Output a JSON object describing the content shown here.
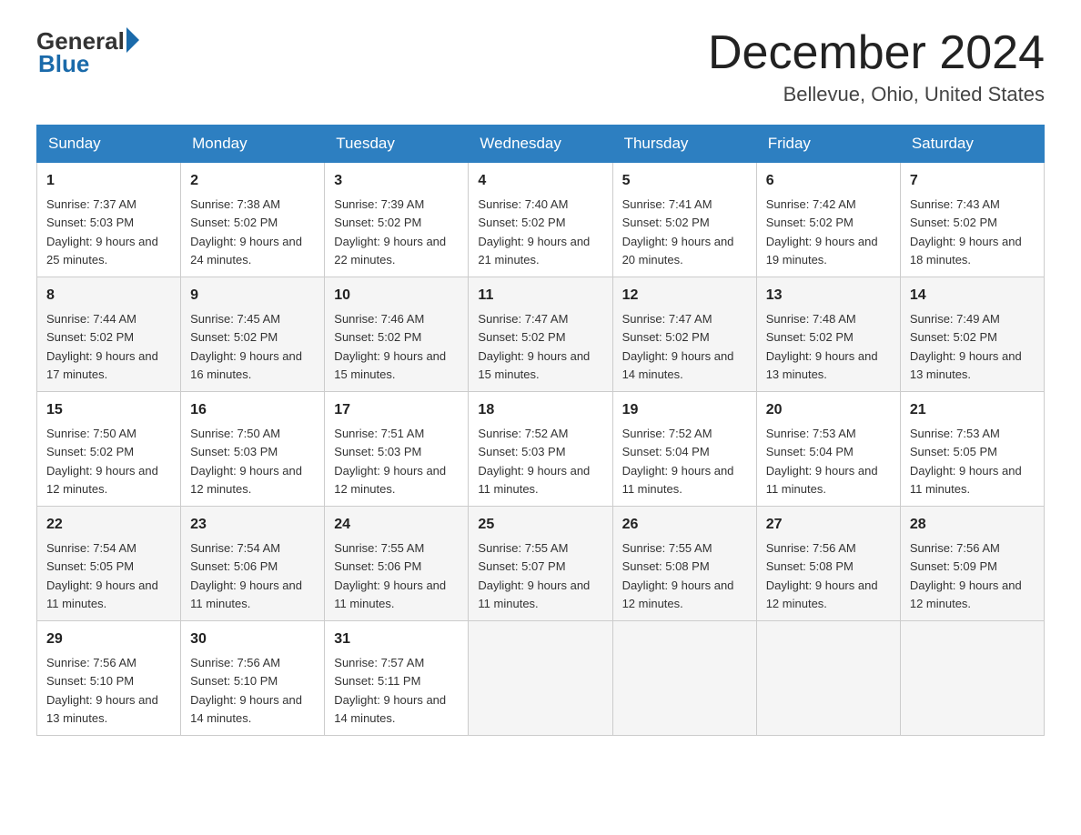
{
  "header": {
    "logo_general": "General",
    "logo_blue": "Blue",
    "month_title": "December 2024",
    "location": "Bellevue, Ohio, United States"
  },
  "days_of_week": [
    "Sunday",
    "Monday",
    "Tuesday",
    "Wednesday",
    "Thursday",
    "Friday",
    "Saturday"
  ],
  "weeks": [
    [
      {
        "day": "1",
        "sunrise": "7:37 AM",
        "sunset": "5:03 PM",
        "daylight": "9 hours and 25 minutes."
      },
      {
        "day": "2",
        "sunrise": "7:38 AM",
        "sunset": "5:02 PM",
        "daylight": "9 hours and 24 minutes."
      },
      {
        "day": "3",
        "sunrise": "7:39 AM",
        "sunset": "5:02 PM",
        "daylight": "9 hours and 22 minutes."
      },
      {
        "day": "4",
        "sunrise": "7:40 AM",
        "sunset": "5:02 PM",
        "daylight": "9 hours and 21 minutes."
      },
      {
        "day": "5",
        "sunrise": "7:41 AM",
        "sunset": "5:02 PM",
        "daylight": "9 hours and 20 minutes."
      },
      {
        "day": "6",
        "sunrise": "7:42 AM",
        "sunset": "5:02 PM",
        "daylight": "9 hours and 19 minutes."
      },
      {
        "day": "7",
        "sunrise": "7:43 AM",
        "sunset": "5:02 PM",
        "daylight": "9 hours and 18 minutes."
      }
    ],
    [
      {
        "day": "8",
        "sunrise": "7:44 AM",
        "sunset": "5:02 PM",
        "daylight": "9 hours and 17 minutes."
      },
      {
        "day": "9",
        "sunrise": "7:45 AM",
        "sunset": "5:02 PM",
        "daylight": "9 hours and 16 minutes."
      },
      {
        "day": "10",
        "sunrise": "7:46 AM",
        "sunset": "5:02 PM",
        "daylight": "9 hours and 15 minutes."
      },
      {
        "day": "11",
        "sunrise": "7:47 AM",
        "sunset": "5:02 PM",
        "daylight": "9 hours and 15 minutes."
      },
      {
        "day": "12",
        "sunrise": "7:47 AM",
        "sunset": "5:02 PM",
        "daylight": "9 hours and 14 minutes."
      },
      {
        "day": "13",
        "sunrise": "7:48 AM",
        "sunset": "5:02 PM",
        "daylight": "9 hours and 13 minutes."
      },
      {
        "day": "14",
        "sunrise": "7:49 AM",
        "sunset": "5:02 PM",
        "daylight": "9 hours and 13 minutes."
      }
    ],
    [
      {
        "day": "15",
        "sunrise": "7:50 AM",
        "sunset": "5:02 PM",
        "daylight": "9 hours and 12 minutes."
      },
      {
        "day": "16",
        "sunrise": "7:50 AM",
        "sunset": "5:03 PM",
        "daylight": "9 hours and 12 minutes."
      },
      {
        "day": "17",
        "sunrise": "7:51 AM",
        "sunset": "5:03 PM",
        "daylight": "9 hours and 12 minutes."
      },
      {
        "day": "18",
        "sunrise": "7:52 AM",
        "sunset": "5:03 PM",
        "daylight": "9 hours and 11 minutes."
      },
      {
        "day": "19",
        "sunrise": "7:52 AM",
        "sunset": "5:04 PM",
        "daylight": "9 hours and 11 minutes."
      },
      {
        "day": "20",
        "sunrise": "7:53 AM",
        "sunset": "5:04 PM",
        "daylight": "9 hours and 11 minutes."
      },
      {
        "day": "21",
        "sunrise": "7:53 AM",
        "sunset": "5:05 PM",
        "daylight": "9 hours and 11 minutes."
      }
    ],
    [
      {
        "day": "22",
        "sunrise": "7:54 AM",
        "sunset": "5:05 PM",
        "daylight": "9 hours and 11 minutes."
      },
      {
        "day": "23",
        "sunrise": "7:54 AM",
        "sunset": "5:06 PM",
        "daylight": "9 hours and 11 minutes."
      },
      {
        "day": "24",
        "sunrise": "7:55 AM",
        "sunset": "5:06 PM",
        "daylight": "9 hours and 11 minutes."
      },
      {
        "day": "25",
        "sunrise": "7:55 AM",
        "sunset": "5:07 PM",
        "daylight": "9 hours and 11 minutes."
      },
      {
        "day": "26",
        "sunrise": "7:55 AM",
        "sunset": "5:08 PM",
        "daylight": "9 hours and 12 minutes."
      },
      {
        "day": "27",
        "sunrise": "7:56 AM",
        "sunset": "5:08 PM",
        "daylight": "9 hours and 12 minutes."
      },
      {
        "day": "28",
        "sunrise": "7:56 AM",
        "sunset": "5:09 PM",
        "daylight": "9 hours and 12 minutes."
      }
    ],
    [
      {
        "day": "29",
        "sunrise": "7:56 AM",
        "sunset": "5:10 PM",
        "daylight": "9 hours and 13 minutes."
      },
      {
        "day": "30",
        "sunrise": "7:56 AM",
        "sunset": "5:10 PM",
        "daylight": "9 hours and 14 minutes."
      },
      {
        "day": "31",
        "sunrise": "7:57 AM",
        "sunset": "5:11 PM",
        "daylight": "9 hours and 14 minutes."
      },
      null,
      null,
      null,
      null
    ]
  ],
  "labels": {
    "sunrise_prefix": "Sunrise: ",
    "sunset_prefix": "Sunset: ",
    "daylight_prefix": "Daylight: "
  }
}
